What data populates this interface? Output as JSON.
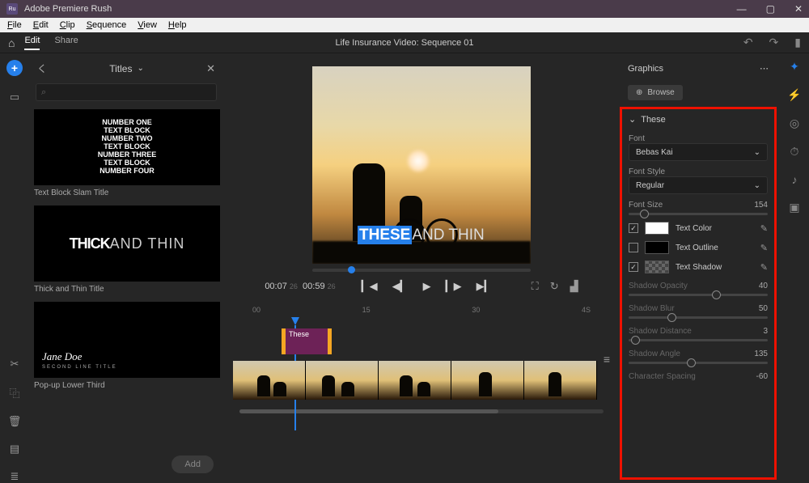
{
  "app": {
    "name": "Adobe Premiere Rush"
  },
  "menu": [
    "File",
    "Edit",
    "Clip",
    "Sequence",
    "View",
    "Help"
  ],
  "tabs": {
    "edit": "Edit",
    "share": "Share"
  },
  "doc_title": "Life Insurance Video: Sequence 01",
  "titles_panel": {
    "header": "Titles",
    "cards": [
      {
        "label": "Text Block Slam Title",
        "lines": [
          "NUMBER ONE",
          "TEXT BLOCK",
          "NUMBER TWO",
          "TEXT BLOCK",
          "NUMBER THREE",
          "TEXT BLOCK",
          "NUMBER FOUR"
        ]
      },
      {
        "label": "Thick and Thin Title",
        "thick": "THICK",
        "thin": "AND THIN"
      },
      {
        "label": "Pop-up Lower Third",
        "name": "Jane Doe",
        "sub": "SECOND LINE TITLE"
      }
    ],
    "add": "Add"
  },
  "preview": {
    "text_sel": "THESE",
    "text_rest": "AND THIN"
  },
  "transport": {
    "cur": "00:07",
    "cur_f": "26",
    "dur": "00:59",
    "dur_f": "26"
  },
  "ruler": [
    "00",
    "15",
    "30",
    "4S"
  ],
  "clip": {
    "label": "These"
  },
  "graphics": {
    "header": "Graphics",
    "browse": "Browse",
    "section": "These",
    "font_label": "Font",
    "font": "Bebas Kai",
    "style_label": "Font Style",
    "style": "Regular",
    "size_label": "Font Size",
    "size": "154",
    "text_color": "Text Color",
    "text_outline": "Text Outline",
    "text_shadow": "Text Shadow",
    "shadow_opacity_l": "Shadow Opacity",
    "shadow_opacity": "40",
    "shadow_blur_l": "Shadow Blur",
    "shadow_blur": "50",
    "shadow_dist_l": "Shadow Distance",
    "shadow_dist": "3",
    "shadow_angle_l": "Shadow Angle",
    "shadow_angle": "135",
    "char_spacing_l": "Character Spacing",
    "char_spacing": "-60"
  }
}
